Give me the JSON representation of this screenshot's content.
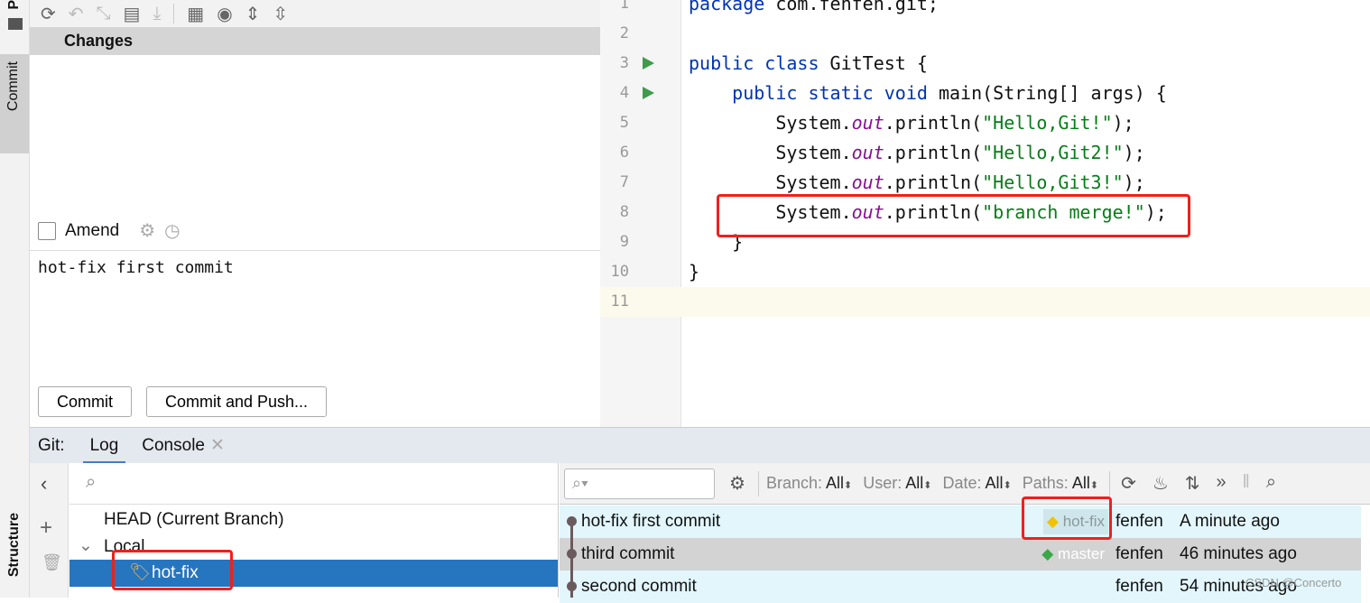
{
  "sidebar": {
    "project_label": "P",
    "commit_label": "Commit",
    "structure_label": "Structure"
  },
  "commit_panel": {
    "changes_header": "Changes",
    "amend_label": "Amend",
    "message": "hot-fix first commit",
    "commit_button": "Commit",
    "commit_push_button": "Commit and Push..."
  },
  "editor": {
    "lines": [
      {
        "n": "1",
        "html": "<span class='kw'>package</span> com.fenfen.git;"
      },
      {
        "n": "2",
        "html": ""
      },
      {
        "n": "3",
        "html": "<span class='kw'>public class</span> GitTest {"
      },
      {
        "n": "4",
        "html": "    <span class='kw'>public static void</span> main(String[] args) {"
      },
      {
        "n": "5",
        "html": "        System.<span class='fld'>out</span>.println(<span class='str'>\"Hello,Git!\"</span>);"
      },
      {
        "n": "6",
        "html": "        System.<span class='fld'>out</span>.println(<span class='str'>\"Hello,Git2!\"</span>);"
      },
      {
        "n": "7",
        "html": "        System.<span class='fld'>out</span>.println(<span class='str'>\"Hello,Git3!\"</span>);"
      },
      {
        "n": "8",
        "html": "        System.<span class='fld'>out</span>.println(<span class='str'>\"branch merge!\"</span>);"
      },
      {
        "n": "9",
        "html": "    }"
      },
      {
        "n": "10",
        "html": "}"
      },
      {
        "n": "11",
        "html": ""
      }
    ]
  },
  "git": {
    "prefix": "Git:",
    "tabs": [
      "Log",
      "Console"
    ],
    "active_tab": "Log"
  },
  "branches": {
    "head": "HEAD (Current Branch)",
    "local": "Local",
    "selected": "hot-fix"
  },
  "log_toolbar": {
    "filters": [
      {
        "label": "Branch:",
        "value": "All"
      },
      {
        "label": "User:",
        "value": "All"
      },
      {
        "label": "Date:",
        "value": "All"
      },
      {
        "label": "Paths:",
        "value": "All"
      }
    ]
  },
  "commits": [
    {
      "message": "hot-fix first commit",
      "ref": "hot-fix",
      "author": "fenfen",
      "time": "A minute ago"
    },
    {
      "message": "third commit",
      "ref": "master",
      "author": "fenfen",
      "time": "46 minutes ago"
    },
    {
      "message": "second commit",
      "ref": "",
      "author": "fenfen",
      "time": "54 minutes ago"
    }
  ],
  "watermark": "CSDN @Concerto",
  "colors": {
    "selection": "#2675bf",
    "highlight": "#f0201a",
    "row_light": "#e2f6fc",
    "row_selected": "#d3d3d3"
  }
}
